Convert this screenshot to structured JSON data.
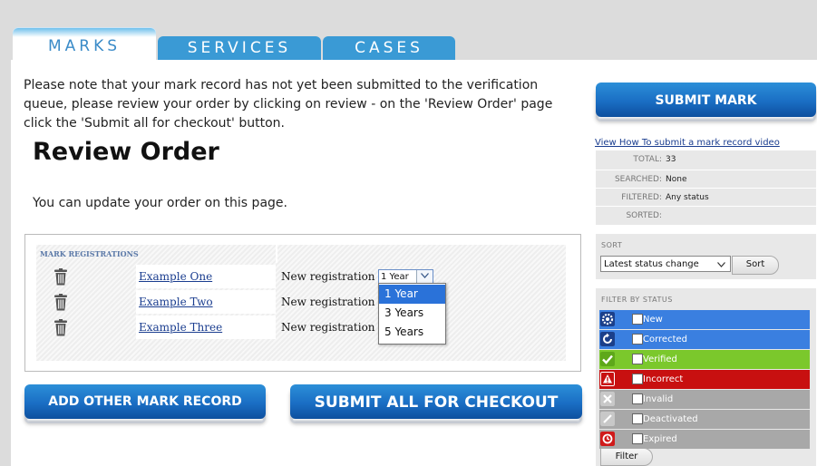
{
  "tabs": [
    {
      "label": "MARKS",
      "active": true
    },
    {
      "label": "SERVICES",
      "active": false
    },
    {
      "label": "CASES",
      "active": false
    }
  ],
  "notice": "Please note that your mark record has not yet been submitted to the verification queue, please review your order by clicking on review - on the 'Review Order' page click the 'Submit all for checkout' button.",
  "page_title": "Review Order",
  "update_text": "You can update your order on this page.",
  "registrations": {
    "header": "MARK REGISTRATIONS",
    "rows": [
      {
        "name": "Example One",
        "label": "New registration for",
        "term": "1 Year"
      },
      {
        "name": "Example Two",
        "label": "New registration for",
        "term": ""
      },
      {
        "name": "Example Three",
        "label": "New registration for",
        "term": ""
      }
    ],
    "dropdown_options": [
      "1 Year",
      "3 Years",
      "5 Years"
    ],
    "dropdown_selected": "1 Year"
  },
  "buttons": {
    "add_other": "ADD OTHER MARK RECORD",
    "submit_all": "SUBMIT ALL FOR CHECKOUT",
    "submit_mark": "SUBMIT MARK"
  },
  "sidebar": {
    "howto_link": "View How To submit a mark record video",
    "stats": {
      "total_label": "TOTAL:",
      "total_value": "33",
      "searched_label": "SEARCHED:",
      "searched_value": "None",
      "filtered_label": "FILTERED:",
      "filtered_value": "Any status",
      "sorted_label": "SORTED:",
      "sorted_value": ""
    },
    "sort": {
      "label": "SORT",
      "selected": "Latest status change",
      "button": "Sort"
    },
    "filter": {
      "label": "FILTER BY STATUS",
      "statuses": [
        {
          "label": "New",
          "color": "#3a7fe0",
          "icon": "gear-icon"
        },
        {
          "label": "Corrected",
          "color": "#3a7fe0",
          "icon": "refresh-icon"
        },
        {
          "label": "Verified",
          "color": "#7bc82c",
          "icon": "check-icon"
        },
        {
          "label": "Incorrect",
          "color": "#c81010",
          "icon": "warning-icon"
        },
        {
          "label": "Invalid",
          "color": "#a8a8a8",
          "icon": "x-icon"
        },
        {
          "label": "Deactivated",
          "color": "#a8a8a8",
          "icon": "slash-icon"
        },
        {
          "label": "Expired",
          "color": "#a8a8a8",
          "icon": "clock-icon"
        }
      ],
      "button": "Filter"
    }
  },
  "colors": {
    "tab_blue": "#3a9ad5",
    "button_blue": "#1a6ec4",
    "link_blue": "#1a3d8f"
  }
}
